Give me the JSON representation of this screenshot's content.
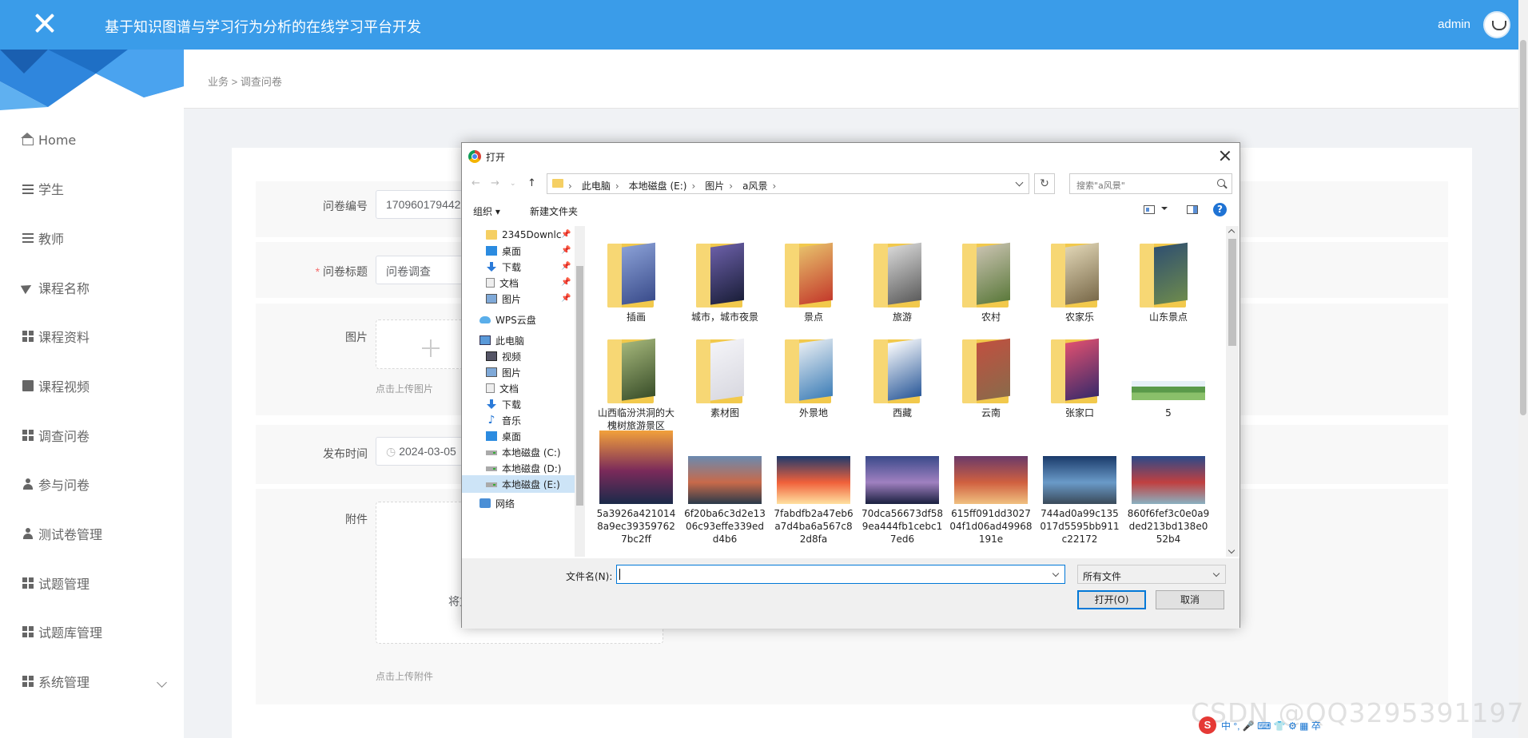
{
  "header": {
    "title": "基于知识图谱与学习行为分析的在线学习平台开发",
    "user": "admin"
  },
  "sidebar": {
    "items": [
      {
        "label": "Home",
        "icon": "home-icon"
      },
      {
        "label": "学生",
        "icon": "sliders-icon"
      },
      {
        "label": "教师",
        "icon": "list-icon"
      },
      {
        "label": "课程名称",
        "icon": "send-icon"
      },
      {
        "label": "课程资料",
        "icon": "grid-icon"
      },
      {
        "label": "课程视频",
        "icon": "doc-icon"
      },
      {
        "label": "调查问卷",
        "icon": "grid-icon"
      },
      {
        "label": "参与问卷",
        "icon": "group-icon"
      },
      {
        "label": "测试卷管理",
        "icon": "user-icon"
      },
      {
        "label": "试题管理",
        "icon": "grid-icon"
      },
      {
        "label": "试题库管理",
        "icon": "grid-icon"
      },
      {
        "label": "系统管理",
        "icon": "grid-icon"
      }
    ]
  },
  "breadcrumb": "业务 > 调查问卷",
  "form": {
    "number_label": "问卷编号",
    "number_value": "170960179442",
    "title_label": "问卷标题",
    "title_required": "*",
    "title_value": "问卷调查",
    "image_label": "图片",
    "image_hint": "点击上传图片",
    "time_label": "发布时间",
    "time_value": "2024-03-05",
    "attach_label": "附件",
    "attach_partial": "将文",
    "attach_hint": "点击上传附件"
  },
  "dialog": {
    "title": "打开",
    "path": [
      "此电脑",
      "本地磁盘 (E:)",
      "图片",
      "a风景"
    ],
    "search_placeholder": "搜索\"a风景\"",
    "organize": "组织 ▾",
    "new_folder": "新建文件夹",
    "tree": [
      {
        "label": "2345Downlc",
        "icon": "folder",
        "pinned": true
      },
      {
        "label": "桌面",
        "icon": "desktop",
        "pinned": true
      },
      {
        "label": "下载",
        "icon": "download",
        "pinned": true
      },
      {
        "label": "文档",
        "icon": "file",
        "pinned": true
      },
      {
        "label": "图片",
        "icon": "picture",
        "pinned": true
      },
      {
        "label": "WPS云盘",
        "icon": "cloud"
      },
      {
        "label": "此电脑",
        "icon": "pc"
      },
      {
        "label": "视频",
        "icon": "video"
      },
      {
        "label": "图片",
        "icon": "picture"
      },
      {
        "label": "文档",
        "icon": "file"
      },
      {
        "label": "下载",
        "icon": "download"
      },
      {
        "label": "音乐",
        "icon": "music"
      },
      {
        "label": "桌面",
        "icon": "desktop"
      },
      {
        "label": "本地磁盘 (C:)",
        "icon": "drive"
      },
      {
        "label": "本地磁盘 (D:)",
        "icon": "drive"
      },
      {
        "label": "本地磁盘 (E:)",
        "icon": "drive",
        "selected": true
      },
      {
        "label": "网络",
        "icon": "network"
      }
    ],
    "folders_row1": [
      "插画",
      "城市，城市夜景",
      "景点",
      "旅游",
      "农村",
      "农家乐",
      "山东景点"
    ],
    "folders_row2": [
      "山西临汾洪洞的大槐树旅游景区",
      "素材图",
      "外景地",
      "西藏",
      "云南",
      "张家口",
      "5"
    ],
    "images_row3": [
      "5a3926a4210148a9ec393597627bc2ff",
      "6f20ba6c3d2e1306c93effe339edd4b6",
      "7fabdfb2a47eb6a7d4ba6a567c82d8fa",
      "70dca56673df589ea444fb1cebc17ed6",
      "615ff091dd302704f1d06ad49968191e",
      "744ad0a99c135017d5595bb911c22172",
      "860f6fef3c0e0a9ded213bd138e052b4"
    ],
    "filename_label": "文件名(N):",
    "filename_value": "",
    "filetype": "所有文件",
    "open_button": "打开(O)",
    "cancel_button": "取消"
  },
  "watermark": "CSDN @QQ3295391197",
  "ime": {
    "s": "S",
    "items": "中 °, 🎤 ⌨ 👕 ⚙ ▦ 卒"
  }
}
